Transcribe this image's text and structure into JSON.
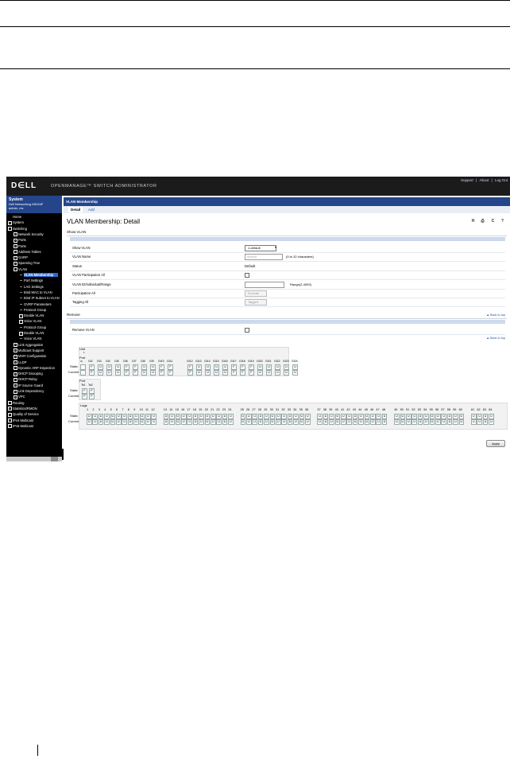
{
  "header": {
    "logo": "D∈LL",
    "app_title": "OPENMANAGE™ SWITCH ADMINISTRATOR",
    "links": [
      "Support",
      "|",
      "About",
      "|",
      "Log Out"
    ]
  },
  "system": {
    "title": "System",
    "model": "Dell Networking N3024F",
    "user": "admin, r/w"
  },
  "nav": [
    {
      "label": "Home",
      "indent": 0,
      "exp": ""
    },
    {
      "label": "System",
      "indent": 0,
      "exp": "+"
    },
    {
      "label": "Switching",
      "indent": 0,
      "exp": "-"
    },
    {
      "label": "Network Security",
      "indent": 1,
      "exp": "+"
    },
    {
      "label": "Ports",
      "indent": 1,
      "exp": "+"
    },
    {
      "label": "Ports",
      "indent": 1,
      "exp": "+"
    },
    {
      "label": "Address Tables",
      "indent": 1,
      "exp": "+"
    },
    {
      "label": "GARP",
      "indent": 1,
      "exp": "+"
    },
    {
      "label": "Spanning Tree",
      "indent": 1,
      "exp": "+"
    },
    {
      "label": "VLAN",
      "indent": 1,
      "exp": "-"
    },
    {
      "label": "VLAN Membership",
      "indent": 2,
      "exp": "",
      "selected": true
    },
    {
      "label": "Port Settings",
      "indent": 2,
      "exp": ""
    },
    {
      "label": "LAG Settings",
      "indent": 2,
      "exp": ""
    },
    {
      "label": "Bind MAC to VLAN",
      "indent": 2,
      "exp": ""
    },
    {
      "label": "Bind IP Subnet to VLAN",
      "indent": 2,
      "exp": ""
    },
    {
      "label": "GVRP Parameters",
      "indent": 2,
      "exp": ""
    },
    {
      "label": "Protocol Group",
      "indent": 2,
      "exp": ""
    },
    {
      "label": "Double VLAN",
      "indent": 2,
      "exp": "+"
    },
    {
      "label": "Voice VLAN",
      "indent": 2,
      "exp": "+"
    },
    {
      "label": "Protocol Group",
      "indent": 2,
      "exp": ""
    },
    {
      "label": "Double VLAN",
      "indent": 2,
      "exp": "+"
    },
    {
      "label": "Voice VLAN",
      "indent": 2,
      "exp": ""
    },
    {
      "label": "Link Aggregation",
      "indent": 1,
      "exp": "+"
    },
    {
      "label": "Multicast Support",
      "indent": 1,
      "exp": "+"
    },
    {
      "label": "MVR Configuration",
      "indent": 1,
      "exp": "+"
    },
    {
      "label": "LLDP",
      "indent": 1,
      "exp": "+"
    },
    {
      "label": "Dynamic ARP Inspection",
      "indent": 1,
      "exp": "+"
    },
    {
      "label": "DHCP Snooping",
      "indent": 1,
      "exp": "+"
    },
    {
      "label": "DHCP Relay",
      "indent": 1,
      "exp": "+"
    },
    {
      "label": "IP Source Guard",
      "indent": 1,
      "exp": "+"
    },
    {
      "label": "Link Dependency",
      "indent": 1,
      "exp": "+"
    },
    {
      "label": "VPC",
      "indent": 1,
      "exp": "+"
    },
    {
      "label": "Routing",
      "indent": 0,
      "exp": "+"
    },
    {
      "label": "Statistics/RMON",
      "indent": 0,
      "exp": "+"
    },
    {
      "label": "Quality of Service",
      "indent": 0,
      "exp": "+"
    },
    {
      "label": "IPv4 Multicast",
      "indent": 0,
      "exp": "+"
    },
    {
      "label": "IPv6 Multicast",
      "indent": 0,
      "exp": "+"
    }
  ],
  "breadcrumb": "VLAN Membership",
  "tabs": [
    {
      "label": "Detail",
      "active": true
    },
    {
      "label": "Add",
      "active": false
    }
  ],
  "page_title": "VLAN Membership: Detail",
  "toolbar_icons": [
    "save-icon",
    "print-icon",
    "refresh-icon",
    "help-icon"
  ],
  "toolbar_glyphs": [
    "H",
    "⎙",
    "C",
    "?"
  ],
  "show_vlan": {
    "section": "Show VLAN",
    "rows": [
      {
        "label": "Show VLAN",
        "type": "select",
        "value": "1-default"
      },
      {
        "label": "VLAN Name",
        "type": "text",
        "value": "default",
        "hint": "(0 to 32 characters)"
      },
      {
        "label": "Status",
        "type": "plain",
        "value": "Default"
      },
      {
        "label": "VLAN Participation All",
        "type": "checkbox"
      },
      {
        "label": "VLAN ID/Individual/Range",
        "type": "text",
        "value": "",
        "hint": "Range(2-4093)"
      },
      {
        "label": "Participation All",
        "type": "select-disabled",
        "value": "Exclude"
      },
      {
        "label": "Tagging All",
        "type": "select-disabled",
        "value": "Tagged"
      }
    ]
  },
  "remove": {
    "section": "Remove",
    "back_to_top": "▲ Back to top",
    "rows": [
      {
        "label": "Remove VLAN",
        "type": "checkbox"
      }
    ],
    "back_to_top_2": "▲ Back to top"
  },
  "unit_grid": {
    "title": "Unit",
    "sub": "1",
    "port_label": "Port",
    "gi_label": "Gi",
    "ports": [
      "Gi2",
      "Gi3",
      "Gi4",
      "Gi5",
      "Gi6",
      "Gi7",
      "Gi8",
      "Gi9",
      "Gi10",
      "Gi11",
      "Gi12",
      "Gi13",
      "Gi14",
      "Gi15",
      "Gi16",
      "Gi17",
      "Gi18",
      "Gi19",
      "Gi20",
      "Gi21",
      "Gi22",
      "Gi23",
      "Gi24"
    ],
    "static_label": "Static",
    "current_label": "Current",
    "static": [
      "F",
      "U",
      "U",
      "U",
      "F",
      "F",
      "U",
      "U",
      "F",
      "F",
      "F",
      "U",
      "U",
      "U",
      "U",
      "F",
      "F",
      "F",
      "U",
      "U",
      "U",
      "U",
      "U"
    ],
    "current": [
      "F",
      "U",
      "U",
      "U",
      "F",
      "F",
      "U",
      "U",
      "F",
      "F",
      "F",
      "U",
      "U",
      "U",
      "U",
      "F",
      "F",
      "F",
      "U",
      "U",
      "U",
      "U",
      "U"
    ]
  },
  "te_grid": {
    "title": "Port",
    "ports": [
      "Te1",
      "Te2"
    ],
    "static_label": "Static",
    "current_label": "Current",
    "static": [
      "F",
      "F"
    ],
    "current": [
      "F",
      "F"
    ]
  },
  "lag_grid": {
    "title": "Lags",
    "lags": [
      1,
      2,
      3,
      4,
      5,
      6,
      7,
      8,
      9,
      10,
      11,
      12,
      13,
      14,
      15,
      16,
      17,
      18,
      19,
      20,
      21,
      22,
      23,
      24,
      25,
      26,
      27,
      28,
      29,
      30,
      31,
      32,
      33,
      34,
      35,
      36,
      37,
      38,
      39,
      40,
      41,
      42,
      43,
      44,
      45,
      46,
      47,
      48,
      49,
      50,
      51,
      52,
      53,
      54,
      55,
      56,
      57,
      58,
      59,
      60,
      61,
      62,
      63,
      64
    ],
    "static_label": "Static",
    "current_label": "Current",
    "value": "U"
  },
  "apply_label": "Apply"
}
